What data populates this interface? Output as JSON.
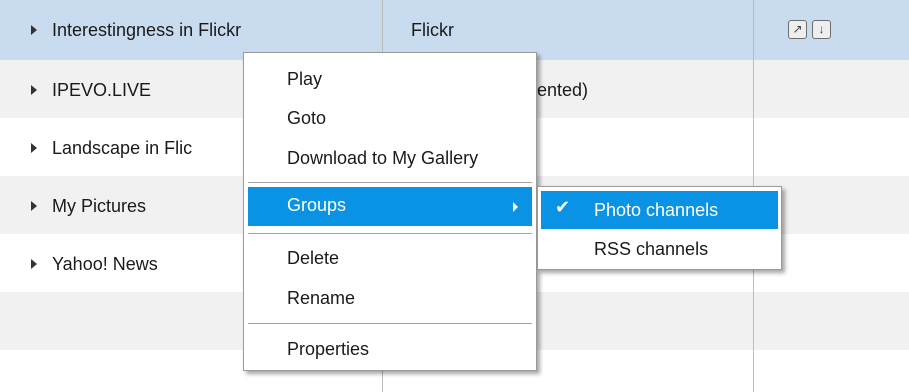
{
  "table": {
    "rows": [
      {
        "name": "Interestingness in Flickr",
        "source": "Flickr"
      },
      {
        "name": "IPEVO.LIVE",
        "source": "ented)"
      },
      {
        "name": "Landscape in Flic",
        "source": ""
      },
      {
        "name": "My Pictures",
        "source": ""
      },
      {
        "name": "Yahoo! News",
        "source": ""
      }
    ],
    "actions": {
      "open_icon": "external-link-icon",
      "download_icon": "download-icon",
      "open_glyph": "↗",
      "download_glyph": "↓"
    }
  },
  "context_menu": {
    "items": {
      "play": "Play",
      "goto": "Goto",
      "download": "Download to My Gallery",
      "groups": "Groups",
      "delete": "Delete",
      "rename": "Rename",
      "properties": "Properties"
    },
    "submenu": {
      "photo_channels": "Photo channels",
      "rss_channels": "RSS channels",
      "check": "✔"
    }
  },
  "colors": {
    "selected_row": "#c9dcef",
    "highlight": "#0a93e4"
  }
}
